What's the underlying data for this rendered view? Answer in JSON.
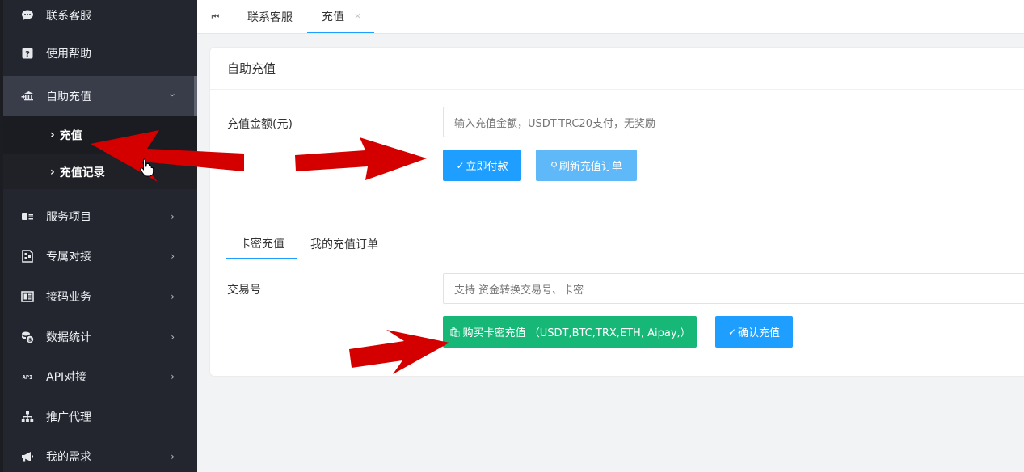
{
  "sidebar": {
    "items": [
      {
        "label": "联系客服",
        "icon": "chat-icon",
        "has_arrow": false
      },
      {
        "label": "使用帮助",
        "icon": "help-icon",
        "has_arrow": false
      },
      {
        "label": "自助充值",
        "icon": "bank-icon",
        "has_arrow": true,
        "open": true
      },
      {
        "label": "服务项目",
        "icon": "id-card-icon",
        "has_arrow": true
      },
      {
        "label": "专属对接",
        "icon": "template-icon",
        "has_arrow": true
      },
      {
        "label": "接码业务",
        "icon": "table-icon",
        "has_arrow": true
      },
      {
        "label": "数据统计",
        "icon": "coins-icon",
        "has_arrow": true
      },
      {
        "label": "API对接",
        "icon": "api-icon",
        "has_arrow": true
      },
      {
        "label": "推广代理",
        "icon": "sitemap-icon",
        "has_arrow": false
      },
      {
        "label": "我的需求",
        "icon": "megaphone-icon",
        "has_arrow": true
      }
    ],
    "submenu": [
      {
        "label": "充值",
        "active": true
      },
      {
        "label": "充值记录",
        "active": false
      }
    ],
    "arrow_glyph": "›",
    "chevron_glyph": "›"
  },
  "tabbar": {
    "home_icon": "⏮",
    "tabs": [
      {
        "label": "联系客服",
        "active": false
      },
      {
        "label": "充值",
        "active": true,
        "close": "×"
      }
    ]
  },
  "card": {
    "title": "自助充值",
    "amount_label": "充值金额(元)",
    "amount_placeholder": "输入充值金额，USDT-TRC20支付，无奖励",
    "pay_button": "立即付款",
    "refresh_button": "刷新充值订单",
    "subtabs": [
      "卡密充值",
      "我的充值订单"
    ],
    "txn_label": "交易号",
    "txn_placeholder": "支持 资金转换交易号、卡密",
    "buy_button": "购买卡密充值 （USDT,BTC,TRX,ETH, Aipay,）",
    "confirm_button": "确认充值"
  },
  "colors": {
    "sidebar_bg": "#23262e",
    "primary": "#1e9fff",
    "primary_light": "#5fb8f7",
    "success": "#16b777",
    "annotation_arrow": "#d40000"
  }
}
